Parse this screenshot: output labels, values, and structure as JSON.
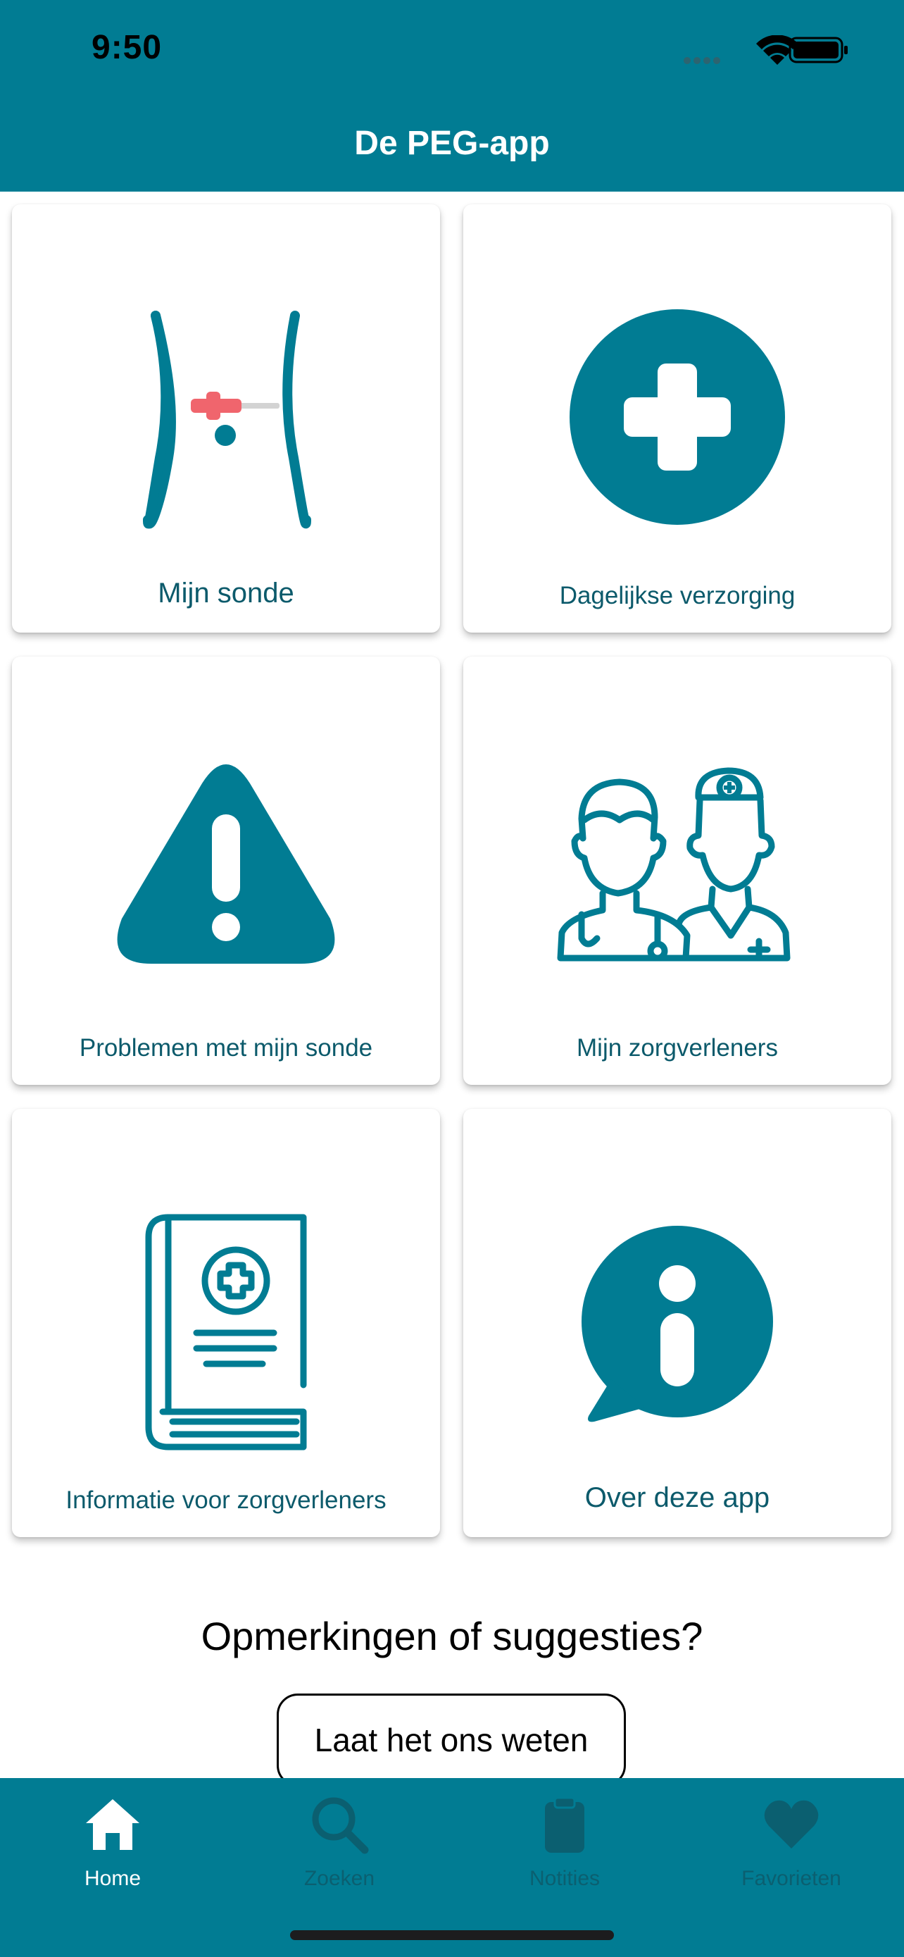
{
  "status_bar": {
    "time": "9:50"
  },
  "header": {
    "title": "De PEG-app"
  },
  "cards": [
    {
      "label": "Mijn sonde",
      "icon": "abdomen-tube-icon"
    },
    {
      "label": "Dagelijkse verzorging",
      "icon": "medical-cross-icon"
    },
    {
      "label": "Problemen met mijn sonde",
      "icon": "warning-triangle-icon"
    },
    {
      "label": "Mijn zorgverleners",
      "icon": "healthcare-providers-icon"
    },
    {
      "label": "Informatie voor zorgverleners",
      "icon": "medical-book-icon"
    },
    {
      "label": "Over deze app",
      "icon": "info-speech-bubble-icon"
    }
  ],
  "feedback": {
    "title": "Opmerkingen of suggesties?",
    "button_label": "Laat het ons weten"
  },
  "tabbar": {
    "items": [
      {
        "label": "Home",
        "icon": "home-icon",
        "active": true
      },
      {
        "label": "Zoeken",
        "icon": "search-icon",
        "active": false
      },
      {
        "label": "Notities",
        "icon": "clipboard-icon",
        "active": false
      },
      {
        "label": "Favorieten",
        "icon": "heart-icon",
        "active": false
      }
    ]
  },
  "colors": {
    "brand": "#017c93",
    "label_text": "#0c5a6b",
    "tube_red": "#f0656d",
    "inactive_tab": "#0b5f70"
  }
}
